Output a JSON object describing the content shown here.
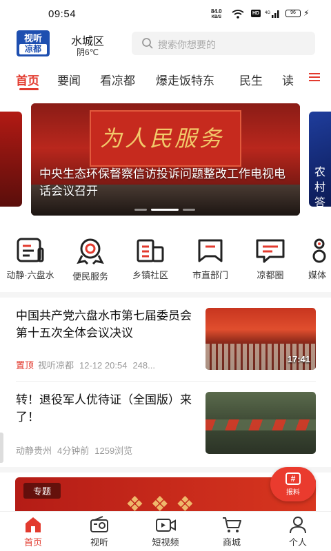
{
  "status_bar": {
    "time": "09:54",
    "net_speed": "84.0",
    "net_unit": "KB/S",
    "hd": "HD",
    "signal": "4G",
    "battery": "96"
  },
  "header": {
    "logo_line1": "视听",
    "logo_line2": "凉都",
    "location": "水城区",
    "weather": "阴6℃",
    "search_placeholder": "搜索你想要的"
  },
  "tabs": [
    "首页",
    "要闻",
    "看凉都",
    "爆走饭特东",
    "民生",
    "读"
  ],
  "banner": {
    "caption": "中央生态环保督察信访投诉问题整改工作电视电话会议召开",
    "board_text": "为人民服务",
    "right_peek_text": "农村答案"
  },
  "quick_entries": [
    {
      "label": "动静·六盘水",
      "icon": "news-icon"
    },
    {
      "label": "便民服务",
      "icon": "badge-icon"
    },
    {
      "label": "乡镇社区",
      "icon": "building-icon"
    },
    {
      "label": "市直部门",
      "icon": "bookmark-icon"
    },
    {
      "label": "凉都圈",
      "icon": "chat-icon"
    },
    {
      "label": "媒体",
      "icon": "media-icon"
    }
  ],
  "news": [
    {
      "title": "中国共产党六盘水市第七届委员会第十五次全体会议决议",
      "tag": "置顶",
      "source": "视听凉都",
      "time": "12-12 20:54",
      "views": "248...",
      "duration": "17:41"
    },
    {
      "title": "转！退役军人优待证（全国版）来了！",
      "tag": "",
      "source": "动静贵州",
      "time": "4分钟前",
      "views": "1259浏览",
      "duration": ""
    }
  ],
  "topic": {
    "tag": "专题"
  },
  "report_button": {
    "label": "报料"
  },
  "bottom_nav": [
    {
      "label": "首页",
      "icon": "home-icon",
      "active": true
    },
    {
      "label": "视听",
      "icon": "radio-icon",
      "active": false
    },
    {
      "label": "短视频",
      "icon": "video-icon",
      "active": false
    },
    {
      "label": "商城",
      "icon": "cart-icon",
      "active": false
    },
    {
      "label": "个人",
      "icon": "person-icon",
      "active": false
    }
  ],
  "colors": {
    "accent": "#e23a2e",
    "logo_blue": "#1e4fb0"
  }
}
